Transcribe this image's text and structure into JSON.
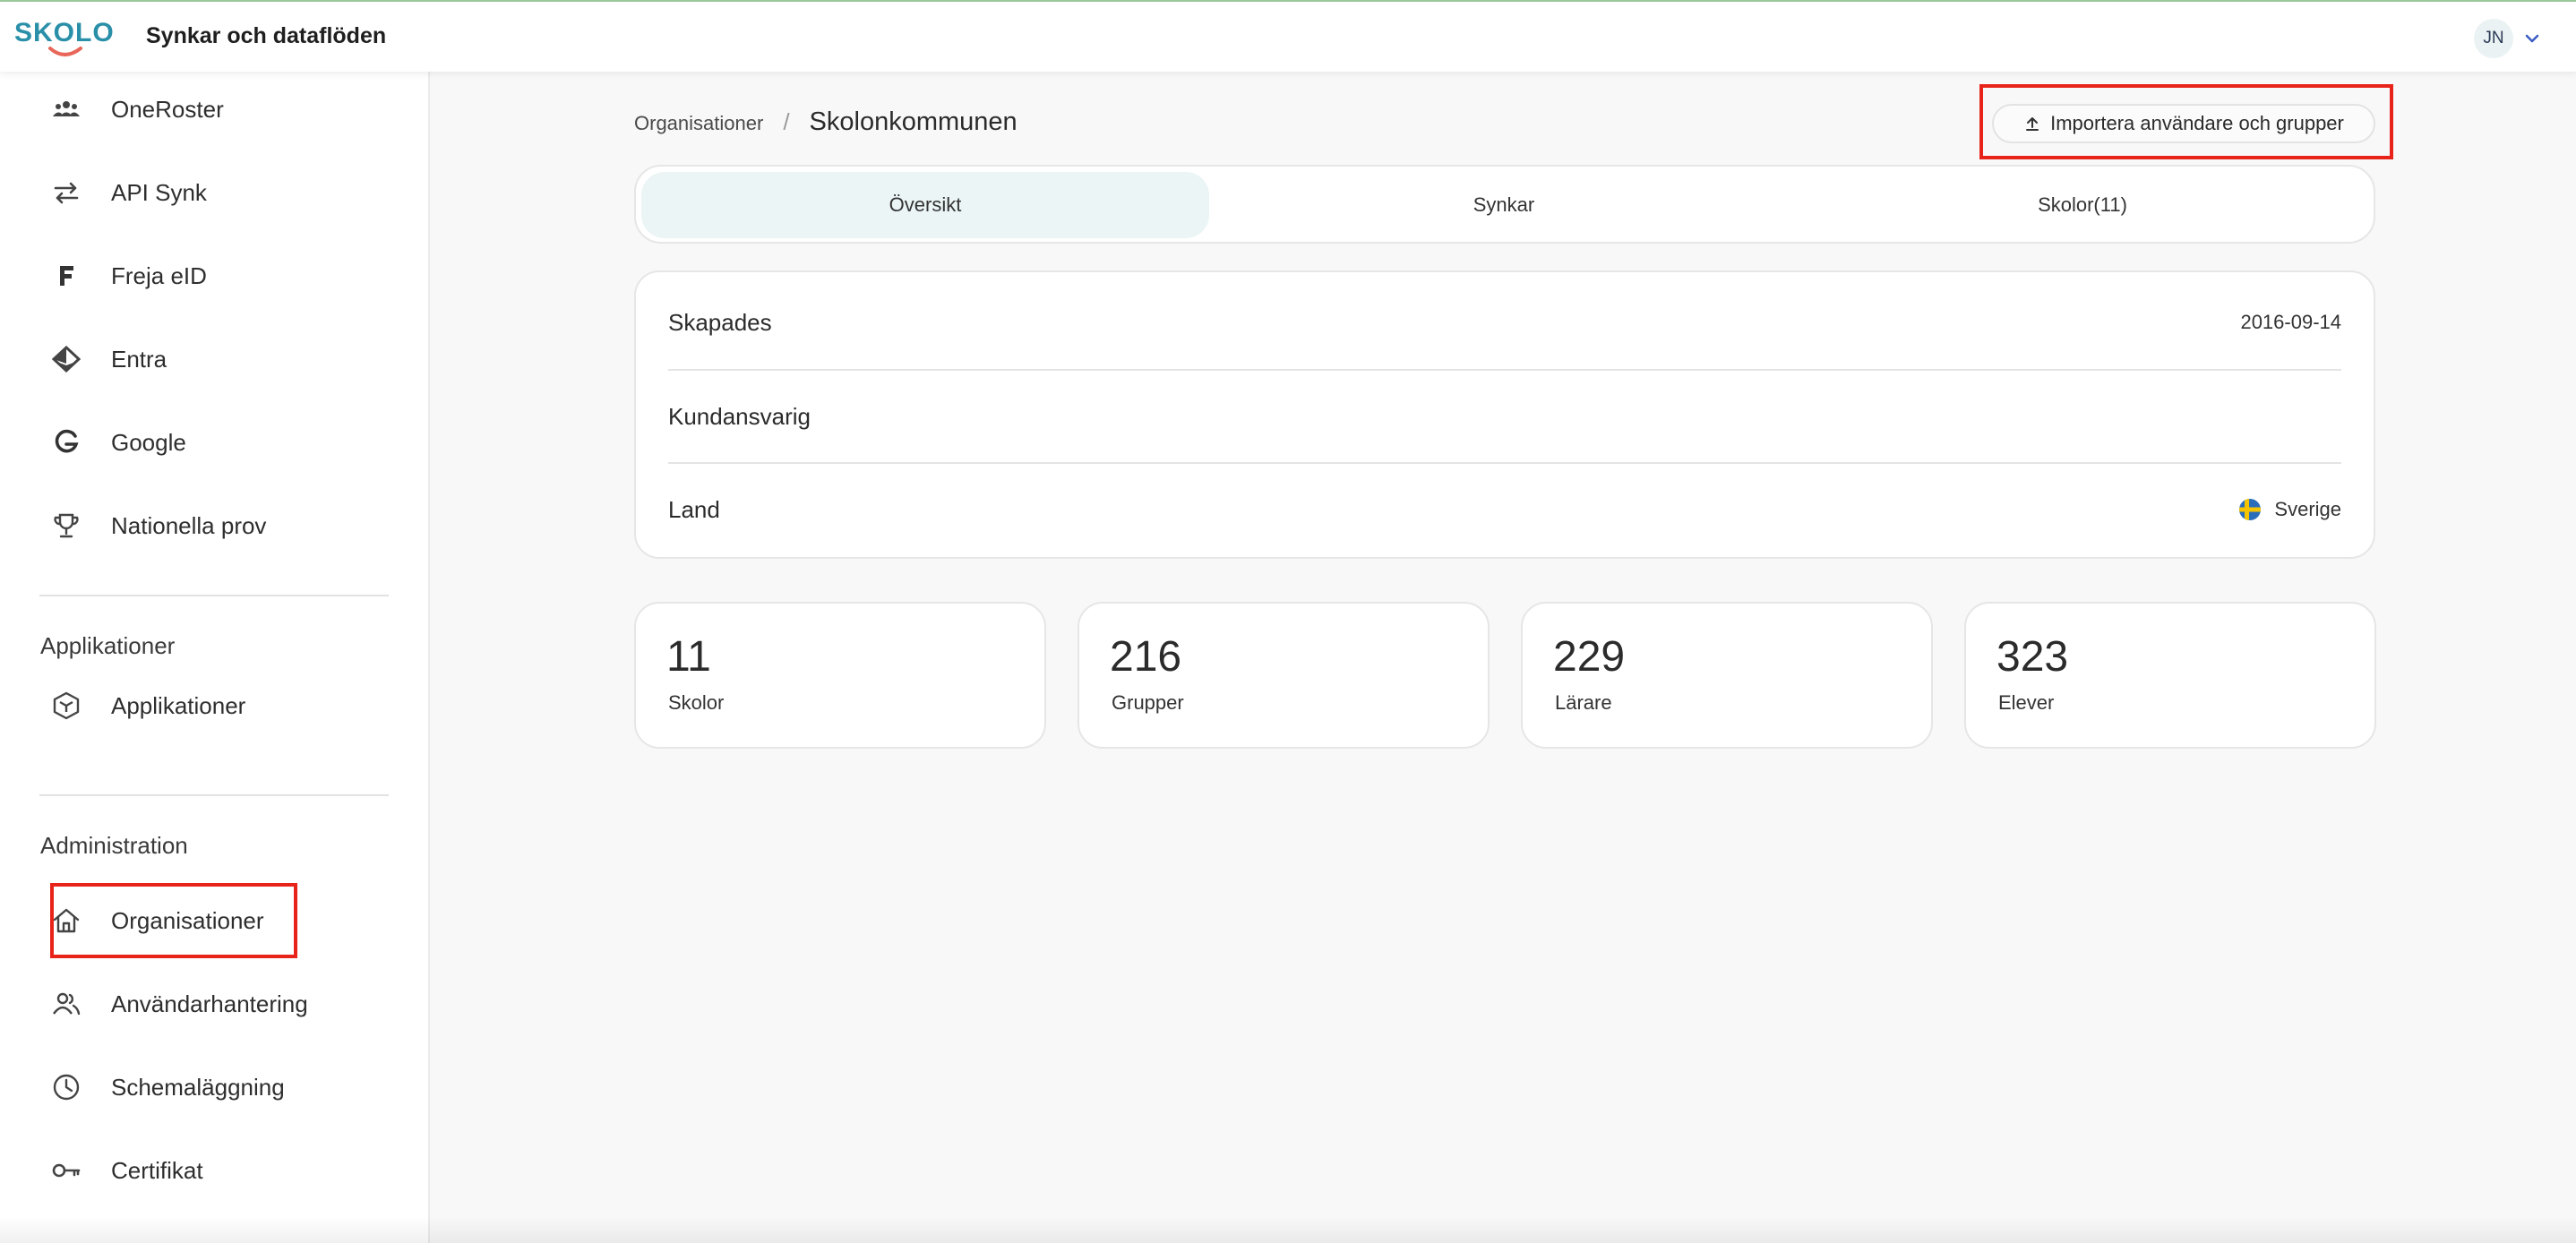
{
  "header": {
    "app_title": "Synkar och dataflöden",
    "user_initials": "JN",
    "logo_text": "SKOLON"
  },
  "sidebar": {
    "items_top": [
      {
        "label": "OneRoster",
        "icon": "users-group-icon"
      },
      {
        "label": "API Synk",
        "icon": "arrows-swap-icon"
      },
      {
        "label": "Freja eID",
        "icon": "freja-f-icon"
      },
      {
        "label": "Entra",
        "icon": "entra-diamond-icon"
      },
      {
        "label": "Google",
        "icon": "google-g-icon"
      },
      {
        "label": "Nationella prov",
        "icon": "trophy-icon"
      }
    ],
    "section_apps": "Applikationer",
    "apps_items": [
      {
        "label": "Applikationer",
        "icon": "cube-icon"
      }
    ],
    "section_admin": "Administration",
    "admin_items": [
      {
        "label": "Organisationer",
        "icon": "home-icon"
      },
      {
        "label": "Användarhantering",
        "icon": "users-icon"
      },
      {
        "label": "Schemaläggning",
        "icon": "clock-icon"
      },
      {
        "label": "Certifikat",
        "icon": "key-icon"
      }
    ]
  },
  "breadcrumb": {
    "parent": "Organisationer",
    "separator": "/",
    "current": "Skolonkommunen"
  },
  "import_button": "Importera användare och grupper",
  "tabs": [
    {
      "label": "Översikt",
      "active": true
    },
    {
      "label": "Synkar",
      "active": false
    },
    {
      "label": "Skolor(11)",
      "active": false
    }
  ],
  "info": [
    {
      "label": "Skapades",
      "value": "2016-09-14"
    },
    {
      "label": "Kundansvarig",
      "value": ""
    },
    {
      "label": "Land",
      "value": "Sverige"
    }
  ],
  "stats": [
    {
      "value": "11",
      "label": "Skolor"
    },
    {
      "value": "216",
      "label": "Grupper"
    },
    {
      "value": "229",
      "label": "Lärare"
    },
    {
      "value": "323",
      "label": "Elever"
    }
  ],
  "colors": {
    "highlight": "#e8231a",
    "active_tab": "#ebf5f6",
    "logo_teal": "#2a8fa8",
    "logo_coral": "#e8675a"
  }
}
